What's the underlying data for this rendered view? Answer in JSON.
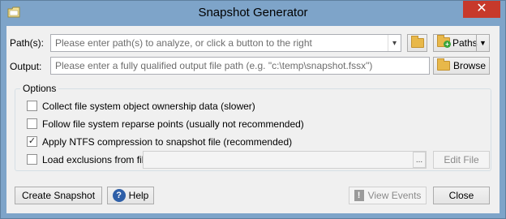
{
  "window": {
    "title": "Snapshot Generator",
    "close_glyph": "✕"
  },
  "paths": {
    "label": "Path(s):",
    "placeholder": "Please enter path(s) to analyze, or click a button to the right",
    "dropdown_glyph": "▾",
    "paths_button_label": "Paths",
    "paths_dropdown_glyph": "▼"
  },
  "output": {
    "label": "Output:",
    "placeholder": "Please enter a fully qualified output file path (e.g. \"c:\\temp\\snapshot.fssx\")",
    "browse_label": "Browse"
  },
  "options": {
    "legend": "Options",
    "items": [
      {
        "label": "Collect file system object ownership data (slower)",
        "checked": false
      },
      {
        "label": "Follow file system reparse points (usually not recommended)",
        "checked": false
      },
      {
        "label": "Apply NTFS compression to snapshot file (recommended)",
        "checked": true
      },
      {
        "label": "Load exclusions from file:",
        "checked": false
      }
    ],
    "exclusions_ellipsis": "...",
    "edit_file_label": "Edit File"
  },
  "footer": {
    "create_label": "Create Snapshot",
    "help_label": "Help",
    "view_events_label": "View Events",
    "close_label": "Close"
  },
  "icons": {
    "app": "folder-icon",
    "help": "question-icon",
    "warning": "exclamation-icon",
    "paths": "folder-add-icon"
  },
  "colors": {
    "titlebar": "#7ea4c9",
    "close": "#c7392b",
    "help_icon": "#2e5fa8"
  }
}
